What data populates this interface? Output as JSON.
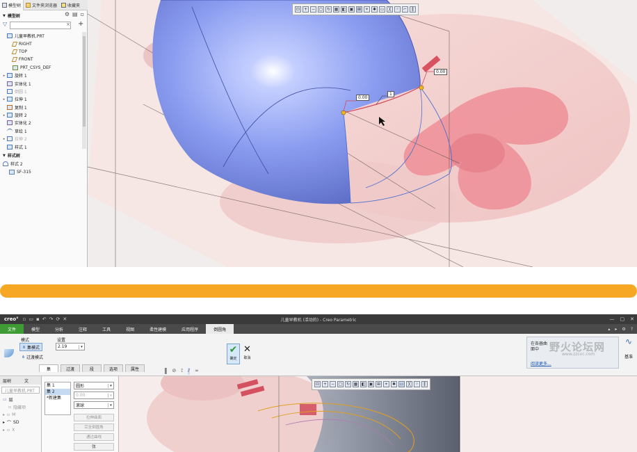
{
  "top": {
    "tabs": [
      {
        "label": "模型树"
      },
      {
        "label": "文件夹浏览器"
      },
      {
        "label": "收藏夹"
      }
    ],
    "tree_title": "模型树",
    "tree_items": [
      {
        "label": "儿童早教机.PRT",
        "dim": false,
        "expand": ""
      },
      {
        "label": "RIGHT",
        "dim": false,
        "expand": ""
      },
      {
        "label": "TOP",
        "dim": false,
        "expand": ""
      },
      {
        "label": "FRONT",
        "dim": false,
        "expand": ""
      },
      {
        "label": "PRT_CSYS_DEF",
        "dim": false,
        "expand": ""
      },
      {
        "label": "旋转 1",
        "dim": false,
        "expand": "▸"
      },
      {
        "label": "实体化 1",
        "dim": false,
        "expand": ""
      },
      {
        "label": "倒圆 1",
        "dim": true,
        "expand": ""
      },
      {
        "label": "拉伸 1",
        "dim": false,
        "expand": "▸"
      },
      {
        "label": "复制 1",
        "dim": false,
        "expand": ""
      },
      {
        "label": "旋转 2",
        "dim": false,
        "expand": "▸"
      },
      {
        "label": "实体化 2",
        "dim": false,
        "expand": ""
      },
      {
        "label": "草绘 1",
        "dim": false,
        "expand": ""
      },
      {
        "label": "拉伸 2",
        "dim": true,
        "expand": "▸"
      },
      {
        "label": "样式 1",
        "dim": false,
        "expand": ""
      }
    ],
    "style_tree_title": "样式树",
    "style_items": [
      {
        "label": "样式 2"
      },
      {
        "label": "SF-315"
      }
    ],
    "dim_labels": {
      "d1": "0.00",
      "d2": "0.00",
      "d3": "1"
    }
  },
  "bottom": {
    "logo": "creo°",
    "window_title": "儿童早教机 (活动的) - Creo Parametric",
    "menus": [
      {
        "label": "文件",
        "type": "file"
      },
      {
        "label": "模型",
        "type": ""
      },
      {
        "label": "分析",
        "type": ""
      },
      {
        "label": "注释",
        "type": ""
      },
      {
        "label": "工具",
        "type": ""
      },
      {
        "label": "视图",
        "type": ""
      },
      {
        "label": "柔性建模",
        "type": ""
      },
      {
        "label": "应用程序",
        "type": ""
      },
      {
        "label": "倒圆角",
        "type": "active"
      }
    ],
    "ribbon": {
      "mode_label": "模式",
      "set_mode": "集模式",
      "transition_mode": "过渡模式",
      "settings_label": "设置",
      "radius_value": "2.19",
      "ok_label": "确定",
      "cancel_label": "取消",
      "subtabs": [
        "集",
        "过渡",
        "段",
        "选项",
        "属性"
      ],
      "help_text": "在各器曲面中",
      "learn_more": "阅读更多...",
      "datum_label": "基准",
      "watermark": "野火论坛网",
      "watermark_url": "www.zzcvc.com"
    },
    "left_panel": {
      "tabs": [
        "层树",
        "文"
      ],
      "search_placeholder": "儿童早教机.PRT",
      "items": [
        "层",
        "隐藏项",
        "M",
        "SD",
        "X"
      ]
    },
    "sets_panel": {
      "sets": [
        "集 1",
        "集 2",
        "*新建集"
      ],
      "shape": "圆形",
      "value": "0.00",
      "profile": "滚球",
      "buttons": [
        "拉伸曲面",
        "完全倒圆角",
        "通过曲线",
        "弦"
      ]
    }
  }
}
